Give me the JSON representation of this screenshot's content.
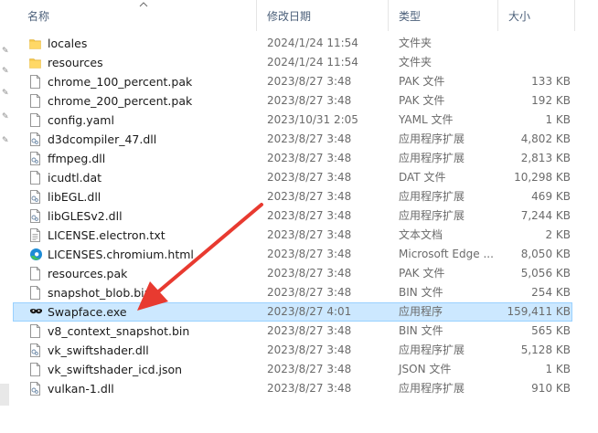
{
  "header": {
    "name": "名称",
    "date": "修改日期",
    "type": "类型",
    "size": "大小"
  },
  "colors": {
    "selected_bg": "#cce8ff",
    "folder": "#f5c748",
    "arrow": "#e83a30"
  },
  "files": [
    {
      "name": "locales",
      "date": "2024/1/24 11:54",
      "type": "文件夹",
      "size": "",
      "icon": "folder-icon"
    },
    {
      "name": "resources",
      "date": "2024/1/24 11:54",
      "type": "文件夹",
      "size": "",
      "icon": "folder-icon"
    },
    {
      "name": "chrome_100_percent.pak",
      "date": "2023/8/27 3:48",
      "type": "PAK 文件",
      "size": "133 KB",
      "icon": "file-icon"
    },
    {
      "name": "chrome_200_percent.pak",
      "date": "2023/8/27 3:48",
      "type": "PAK 文件",
      "size": "192 KB",
      "icon": "file-icon"
    },
    {
      "name": "config.yaml",
      "date": "2023/10/31 2:05",
      "type": "YAML 文件",
      "size": "1 KB",
      "icon": "file-icon"
    },
    {
      "name": "d3dcompiler_47.dll",
      "date": "2023/8/27 3:48",
      "type": "应用程序扩展",
      "size": "4,802 KB",
      "icon": "dll-icon"
    },
    {
      "name": "ffmpeg.dll",
      "date": "2023/8/27 3:48",
      "type": "应用程序扩展",
      "size": "2,813 KB",
      "icon": "dll-icon"
    },
    {
      "name": "icudtl.dat",
      "date": "2023/8/27 3:48",
      "type": "DAT 文件",
      "size": "10,298 KB",
      "icon": "file-icon"
    },
    {
      "name": "libEGL.dll",
      "date": "2023/8/27 3:48",
      "type": "应用程序扩展",
      "size": "469 KB",
      "icon": "dll-icon"
    },
    {
      "name": "libGLESv2.dll",
      "date": "2023/8/27 3:48",
      "type": "应用程序扩展",
      "size": "7,244 KB",
      "icon": "dll-icon"
    },
    {
      "name": "LICENSE.electron.txt",
      "date": "2023/8/27 3:48",
      "type": "文本文档",
      "size": "2 KB",
      "icon": "text-file-icon"
    },
    {
      "name": "LICENSES.chromium.html",
      "date": "2023/8/27 3:48",
      "type": "Microsoft Edge ...",
      "size": "8,050 KB",
      "icon": "edge-icon"
    },
    {
      "name": "resources.pak",
      "date": "2023/8/27 3:48",
      "type": "PAK 文件",
      "size": "5,056 KB",
      "icon": "file-icon"
    },
    {
      "name": "snapshot_blob.bin",
      "date": "2023/8/27 3:48",
      "type": "BIN 文件",
      "size": "254 KB",
      "icon": "file-icon"
    },
    {
      "name": "Swapface.exe",
      "date": "2023/8/27 4:01",
      "type": "应用程序",
      "size": "159,411 KB",
      "icon": "swapface-app-icon",
      "selected": true
    },
    {
      "name": "v8_context_snapshot.bin",
      "date": "2023/8/27 3:48",
      "type": "BIN 文件",
      "size": "565 KB",
      "icon": "file-icon"
    },
    {
      "name": "vk_swiftshader.dll",
      "date": "2023/8/27 3:48",
      "type": "应用程序扩展",
      "size": "5,128 KB",
      "icon": "dll-icon"
    },
    {
      "name": "vk_swiftshader_icd.json",
      "date": "2023/8/27 3:48",
      "type": "JSON 文件",
      "size": "1 KB",
      "icon": "file-icon"
    },
    {
      "name": "vulkan-1.dll",
      "date": "2023/8/27 3:48",
      "type": "应用程序扩展",
      "size": "910 KB",
      "icon": "dll-icon"
    }
  ]
}
